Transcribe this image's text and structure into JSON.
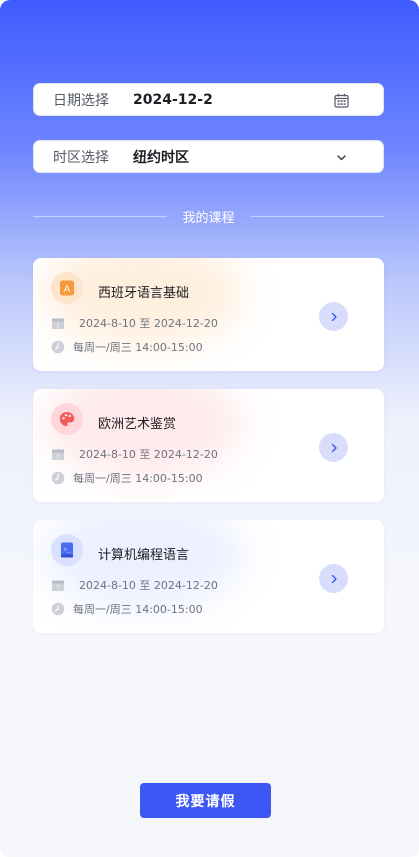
{
  "form": {
    "date": {
      "label": "日期选择",
      "value": "2024-12-2",
      "icon": "calendar-icon"
    },
    "timezone": {
      "label": "时区选择",
      "value": "纽约时区",
      "icon": "chevron-down-icon"
    }
  },
  "section": {
    "title": "我的课程"
  },
  "courses": [
    {
      "title": "西班牙语言基础",
      "date_range": "2024-8-10 至 2024-12-20",
      "schedule": "每周一/周三 14:00-15:00",
      "icon": "language-icon",
      "color": "#f59a3c"
    },
    {
      "title": "欧洲艺术鉴赏",
      "date_range": "2024-8-10 至 2024-12-20",
      "schedule": "每周一/周三 14:00-15:00",
      "icon": "palette-icon",
      "color": "#ef5a5a"
    },
    {
      "title": "计算机编程语言",
      "date_range": "2024-8-10 至 2024-12-20",
      "schedule": "每周一/周三 14:00-15:00",
      "icon": "code-book-icon",
      "color": "#4a6cf0"
    }
  ],
  "actions": {
    "leave_label": "我要请假"
  },
  "colors": {
    "primary": "#3d57f5",
    "header_gradient_top": "#3f5bff"
  }
}
